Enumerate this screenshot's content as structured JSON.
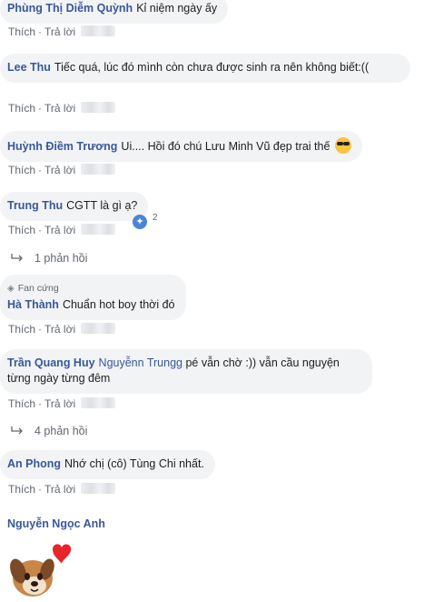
{
  "comments": [
    {
      "author": "Phùng Thị Diễm Quỳnh",
      "text": "Kỉ niệm ngày ấy",
      "like_label": "Thích",
      "reply_label": "Trả lời"
    },
    {
      "author": "Lee Thu",
      "text": "Tiếc quá, lúc đó mình còn chưa được sinh ra nên không biết:((",
      "like_label": "Thích",
      "reply_label": "Trả lời"
    },
    {
      "author": "Huỳnh Điềm Trương",
      "text": "Ui.... Hồi đó chú Lưu Minh Vũ đẹp trai thế",
      "emoji": "sunglasses-emoji",
      "like_label": "Thích",
      "reply_label": "Trả lời"
    },
    {
      "author": "Trung Thu",
      "text": "CGTT là gì ạ?",
      "like_label": "Thích",
      "reply_label": "Trả lời",
      "reaction_count": "2",
      "replies_label": "1 phản hồi"
    },
    {
      "badge": "Fan cứng",
      "author": "Hà Thành",
      "text": "Chuẩn hot boy thời đó",
      "like_label": "Thích",
      "reply_label": "Trả lời"
    },
    {
      "author": "Trần Quang Huy",
      "mention": "Nguyễnn Trungg",
      "text": "pé vẫn chờ :)) vẫn cầu nguyện từng ngày từng đêm",
      "like_label": "Thích",
      "reply_label": "Trả lời",
      "replies_label": "4 phản hồi"
    },
    {
      "author": "An Phong",
      "text": "Nhớ chị (cô) Tùng Chi nhất.",
      "like_label": "Thích",
      "reply_label": "Trả lời"
    },
    {
      "author": "Nguyễn Ngọc Anh",
      "sticker": "puppy-heart-sticker"
    }
  ],
  "colors": {
    "author": "#385898",
    "bubble": "#f2f3f5",
    "meta": "#606770"
  }
}
